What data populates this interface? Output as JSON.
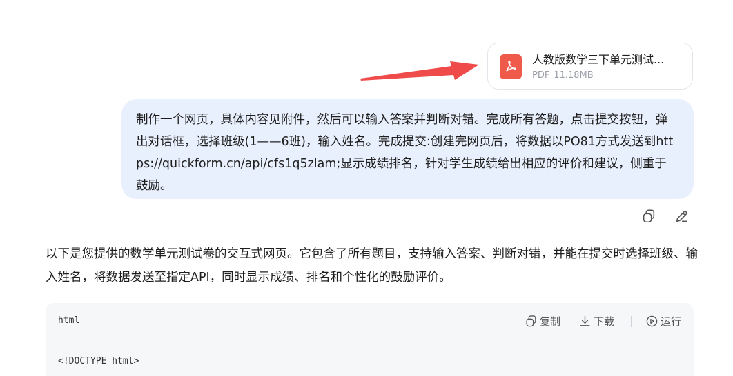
{
  "attachment": {
    "file_name": "人教版数学三下单元测试...",
    "file_type": "PDF",
    "file_size": "11.18MB",
    "icon": "pdf-file-icon"
  },
  "user_message": {
    "text": "制作一个网页，具体内容见附件，然后可以输入答案并判断对错。完成所有答题，点击提交按钮，弹出对话框，选择班级(1——6班)，输入姓名。完成提交:创建完网页后，将数据以PO81方式发送到https://quickform.cn/api/cfs1q5zlam;显示成绩排名，针对学生成绩给出相应的评价和建议，侧重于鼓励。"
  },
  "message_actions": {
    "copy_icon": "copy-icon",
    "edit_icon": "edit-icon"
  },
  "assistant_reply": {
    "text": "以下是您提供的数学单元测试卷的交互式网页。它包含了所有题目，支持输入答案、判断对错，并能在提交时选择班级、输入姓名，将数据发送至指定API，同时显示成绩、排名和个性化的鼓励评价。"
  },
  "code_block": {
    "language": "html",
    "copy_label": "复制",
    "download_label": "下载",
    "run_label": "运行",
    "first_line": "<!DOCTYPE html>"
  },
  "colors": {
    "annotation_arrow": "#ef4b4b",
    "pdf_icon": "#ef5a4a",
    "user_bubble": "#e9f0fd",
    "code_bg": "#f6f7f9"
  }
}
